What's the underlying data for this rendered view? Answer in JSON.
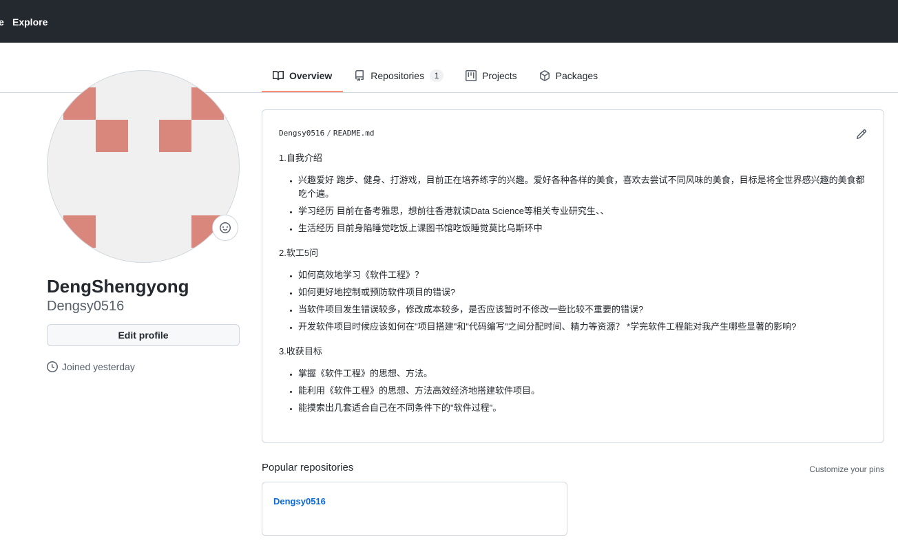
{
  "header": {
    "prev_item_label": "e",
    "explore_label": "Explore"
  },
  "tabs": [
    {
      "label": "Overview",
      "icon": "book-icon",
      "selected": true
    },
    {
      "label": "Repositories",
      "icon": "repo-icon",
      "count": "1"
    },
    {
      "label": "Projects",
      "icon": "project-icon"
    },
    {
      "label": "Packages",
      "icon": "package-icon"
    }
  ],
  "profile": {
    "full_name": "DengShengyong",
    "username": "Dengsy0516",
    "edit_button": "Edit profile",
    "joined": "Joined yesterday",
    "avatar_color": "#d9867c"
  },
  "readme": {
    "owner": "Dengsy0516",
    "separator": "/",
    "file": "README.md",
    "sections": [
      {
        "heading": "1.自我介绍",
        "items": [
          "兴趣爱好 跑步、健身、打游戏，目前正在培养练字的兴趣。爱好各种各样的美食，喜欢去尝试不同风味的美食，目标是将全世界感兴趣的美食都吃个遍。",
          "学习经历 目前在备考雅思，想前往香港就读Data Science等相关专业研究生、、",
          "生活经历 目前身陷睡觉吃饭上课图书馆吃饭睡觉莫比乌斯环中"
        ]
      },
      {
        "heading": "2.软工5问",
        "items": [
          "如何高效地学习《软件工程》？",
          "如何更好地控制或预防软件项目的错误?",
          "当软件项目发生错误较多，修改成本较多，是否应该暂时不修改一些比较不重要的错误?",
          "开发软件项目时候应该如何在\"项目搭建\"和\"代码编写\"之间分配时间、精力等资源？ *学完软件工程能对我产生哪些显著的影响?"
        ]
      },
      {
        "heading": "3.收获目标",
        "items": [
          "掌握《软件工程》的思想、方法。",
          "能利用《软件工程》的思想、方法高效经济地搭建软件项目。",
          "能摸索出几套适合自己在不同条件下的\"软件过程\"。"
        ]
      }
    ]
  },
  "popular": {
    "title": "Popular repositories",
    "customize": "Customize your pins",
    "repos": [
      {
        "name": "Dengsy0516"
      }
    ]
  },
  "colors": {
    "header_bg": "#24292f",
    "tab_underline": "#fd8c73",
    "link": "#0969da",
    "border": "#d0d7de"
  }
}
